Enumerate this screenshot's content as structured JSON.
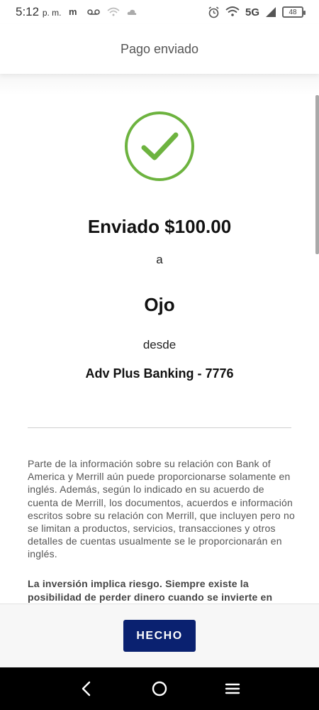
{
  "status_bar": {
    "time": "5:12",
    "ampm": "p. m.",
    "network": "5G",
    "battery": "48"
  },
  "header": {
    "title": "Pago enviado"
  },
  "confirmation": {
    "amount_text": "Enviado $100.00",
    "to_label": "a",
    "recipient": "Ojo",
    "from_label": "desde",
    "account": "Adv Plus Banking - 7776"
  },
  "disclosure": {
    "text": "Parte de la información sobre su relación con Bank of America y Merrill aún puede proporcionarse solamente en inglés. Además, según lo indicado en su acuerdo de cuenta de Merrill, los documentos, acuerdos e información escritos sobre su relación con Merrill, que incluyen pero no se limitan a productos, servicios, transacciones y otros detalles de cuentas usualmente se le proporcionarán en inglés.",
    "risk_text": "La inversión implica riesgo. Siempre existe la posibilidad de perder dinero cuando se invierte en"
  },
  "footer": {
    "done_label": "HECHO"
  },
  "colors": {
    "check_green": "#6db33f",
    "button_navy": "#0a2170"
  },
  "icons": {
    "success": "checkmark-circle-icon",
    "back": "back-chevron-icon",
    "home": "home-circle-icon",
    "menu": "menu-lines-icon"
  }
}
